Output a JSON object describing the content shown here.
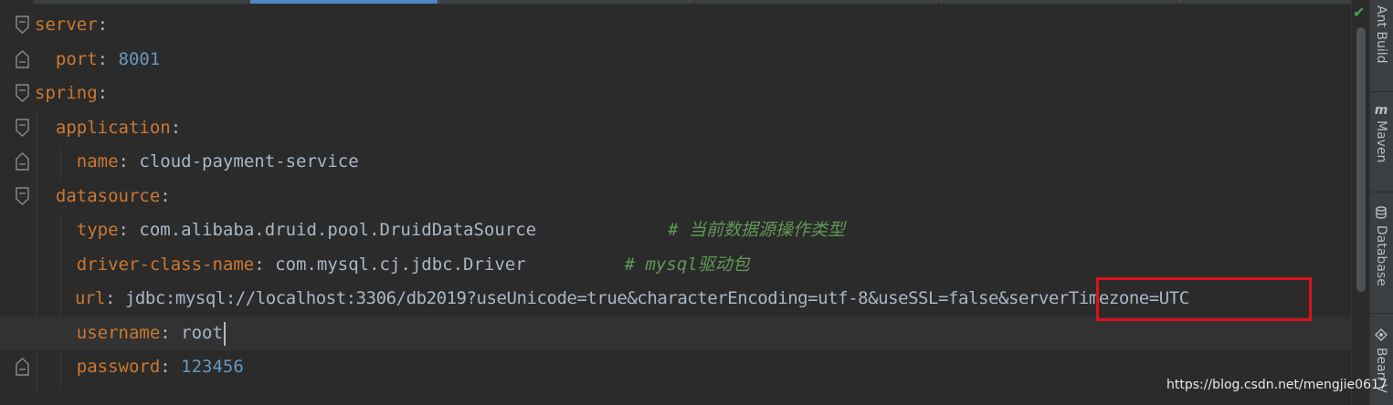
{
  "editor": {
    "lines": [
      {
        "key": "server",
        "colon": ":",
        "value": ""
      },
      {
        "key": "port",
        "colon": ":",
        "value": " 8001"
      },
      {
        "key": "spring",
        "colon": ":",
        "value": ""
      },
      {
        "key": "application",
        "colon": ":",
        "value": ""
      },
      {
        "key": "name",
        "colon": ":",
        "value": " cloud-payment-service"
      },
      {
        "key": "datasource",
        "colon": ":",
        "value": ""
      },
      {
        "key": "type",
        "colon": ":",
        "value": " com.alibaba.druid.pool.DruidDataSource",
        "comment": "# 当前数据源操作类型"
      },
      {
        "key": "driver-class-name",
        "colon": ":",
        "value": " com.mysql.cj.jdbc.Driver",
        "comment": "# mysql驱动包"
      },
      {
        "key": "url",
        "colon": ":",
        "value": " jdbc:mysql://localhost:3306/db2019?useUnicode=true&characterEncoding=utf-8&useSSL=false&serverTimezone=UTC"
      },
      {
        "key": "username",
        "colon": ":",
        "value": " root"
      },
      {
        "key": "password",
        "colon": ":",
        "value": " 123456"
      }
    ]
  },
  "side_tools": {
    "ant_build": "Ant Build",
    "maven": "Maven",
    "maven_icon": "m",
    "database": "Database",
    "bean": "Bean V"
  },
  "status": {
    "inspection_ok_icon": "check-icon",
    "inspection_ok_color": "#49a64b"
  },
  "watermark": "https://blog.csdn.net/mengjie0617",
  "colors": {
    "background": "#2b2b2b",
    "key": "#cc7832",
    "number": "#6897bb",
    "comment": "#629755",
    "highlight_box": "#e0101a"
  }
}
